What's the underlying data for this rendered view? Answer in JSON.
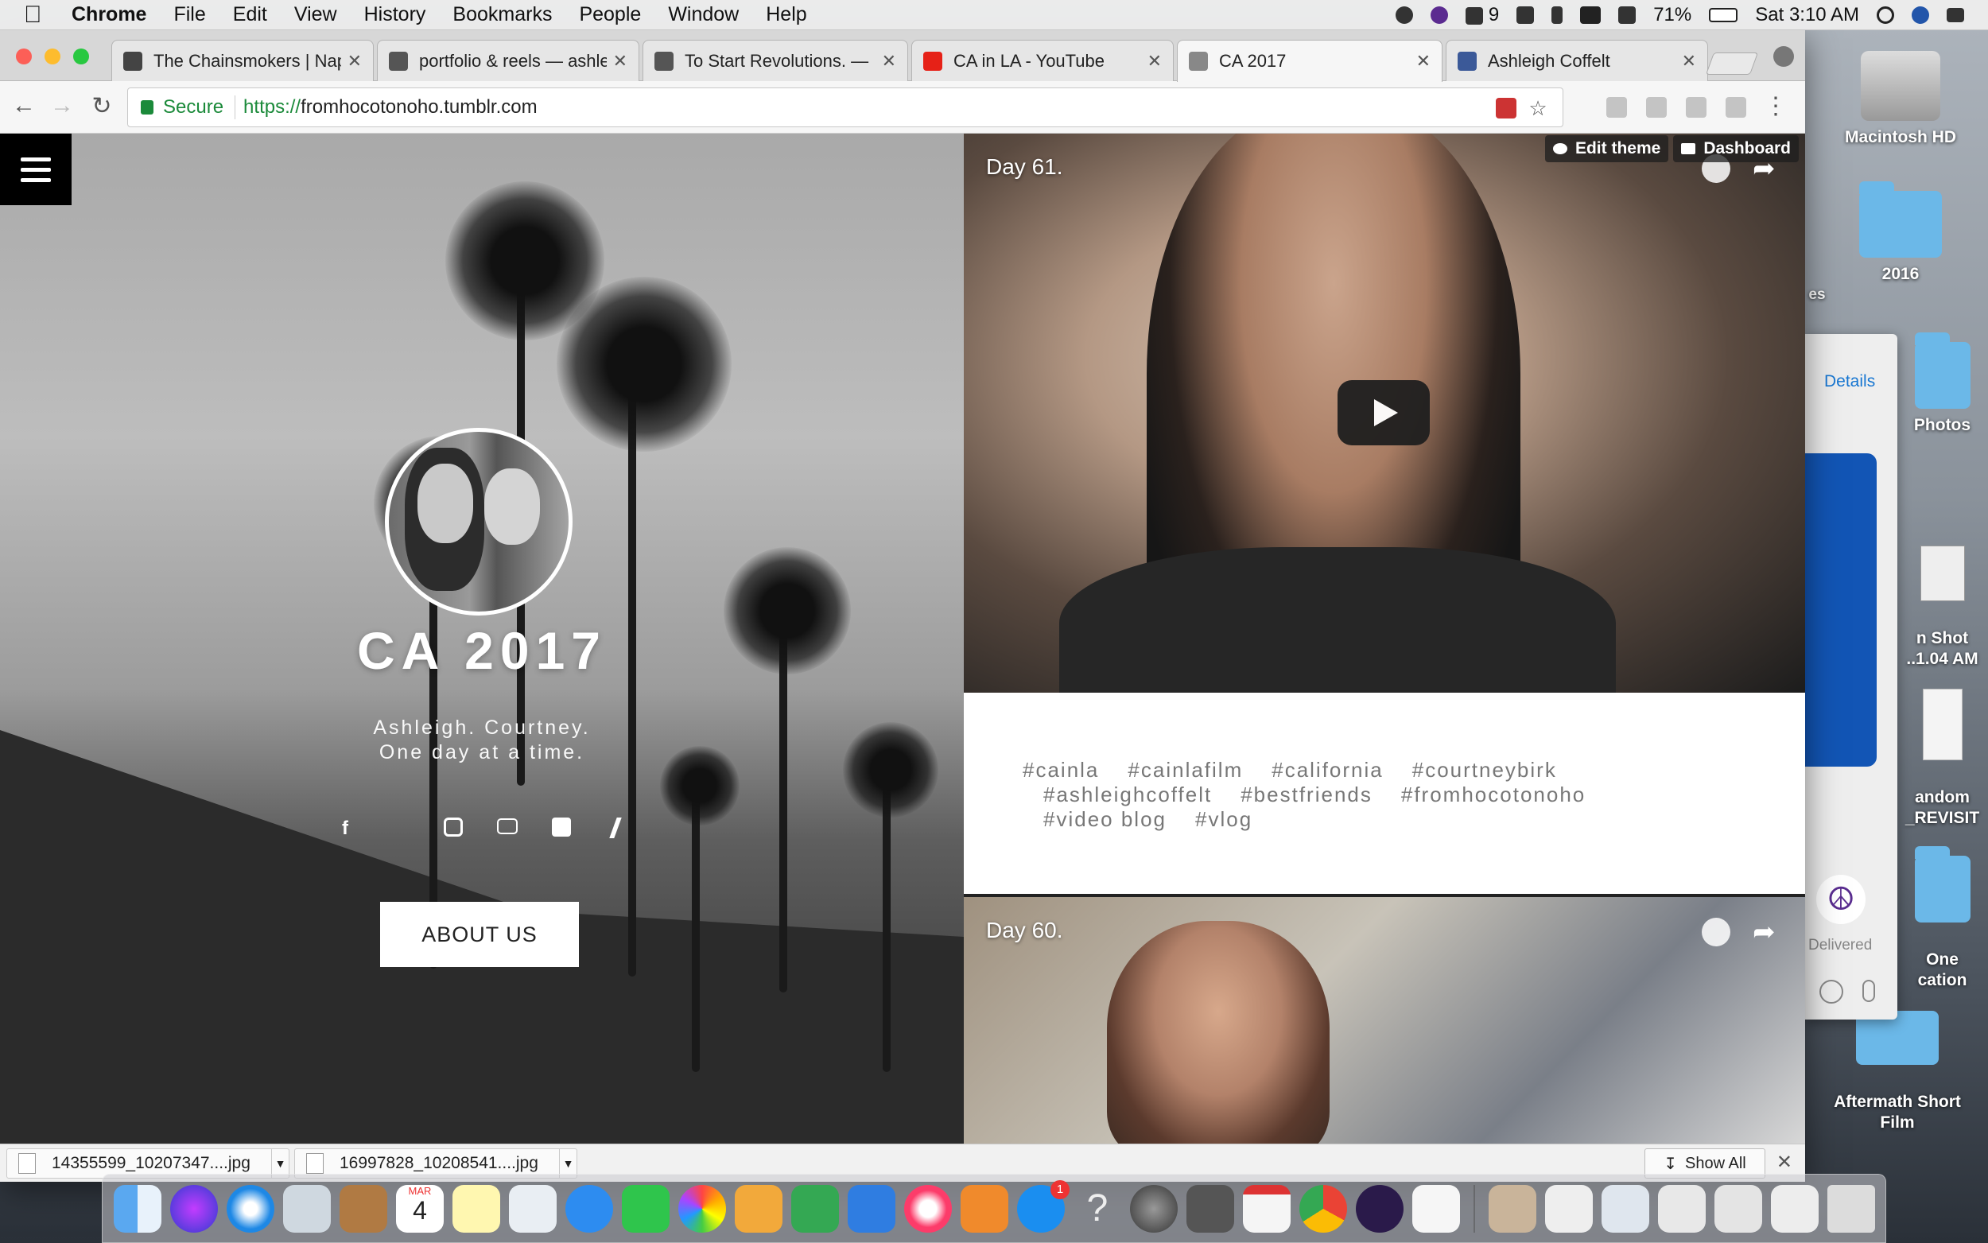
{
  "menubar": {
    "app": "Chrome",
    "items": [
      "File",
      "Edit",
      "View",
      "History",
      "Bookmarks",
      "People",
      "Window",
      "Help"
    ],
    "status_number": "9",
    "battery": "71%",
    "clock": "Sat 3:10 AM"
  },
  "tabs": [
    {
      "title": "The Chainsmokers | Nap",
      "favicon_color": "#444444"
    },
    {
      "title": "portfolio & reels — ashle",
      "favicon_color": "#555555"
    },
    {
      "title": "To Start Revolutions. —",
      "favicon_color": "#555555"
    },
    {
      "title": "CA in LA - YouTube",
      "favicon_color": "#e62117"
    },
    {
      "title": "CA 2017",
      "favicon_color": "#888888"
    },
    {
      "title": "Ashleigh Coffelt",
      "favicon_color": "#3b5998"
    }
  ],
  "omnibox": {
    "secure_label": "Secure",
    "url_scheme": "https://",
    "url_host": "fromhocotonoho.tumblr.com"
  },
  "tumblr": {
    "edit_theme": "Edit theme",
    "dashboard": "Dashboard"
  },
  "blog": {
    "title": "CA 2017",
    "desc_line1": "Ashleigh. Courtney.",
    "desc_line2": "One day at a time.",
    "about_label": "ABOUT US",
    "socials": [
      "f",
      "t",
      "ig",
      "yt",
      "v",
      "z"
    ]
  },
  "posts": {
    "post1_title": "Day 61.",
    "post2_title": "Day 60.",
    "tags_line1": [
      "#cainla",
      "#cainlafilm",
      "#california",
      "#courtneybirk"
    ],
    "tags_line2": [
      "#ashleighcoffelt",
      "#bestfriends",
      "#fromhocotonoho"
    ],
    "tags_line3": [
      "#video blog",
      "#vlog"
    ]
  },
  "downloads": {
    "files": [
      "14355599_10207347....jpg",
      "16997828_10208541....jpg"
    ],
    "show_all": "Show All"
  },
  "desktop_icons": [
    {
      "label": "Macintosh HD"
    },
    {
      "label": "2016"
    },
    {
      "label": "Photos"
    },
    {
      "label": "n Shot\n..1.04 AM"
    },
    {
      "label": "andom\n_REVISIT"
    },
    {
      "label": "One\ncation"
    },
    {
      "label": "Aftermath Short\nFilm"
    }
  ],
  "desktop_partial": "es",
  "messages": {
    "details": "Details",
    "delivered": "Delivered"
  },
  "dock": {
    "calendar_month": "MAR",
    "calendar_day": "4",
    "appstore_badge": "1"
  }
}
